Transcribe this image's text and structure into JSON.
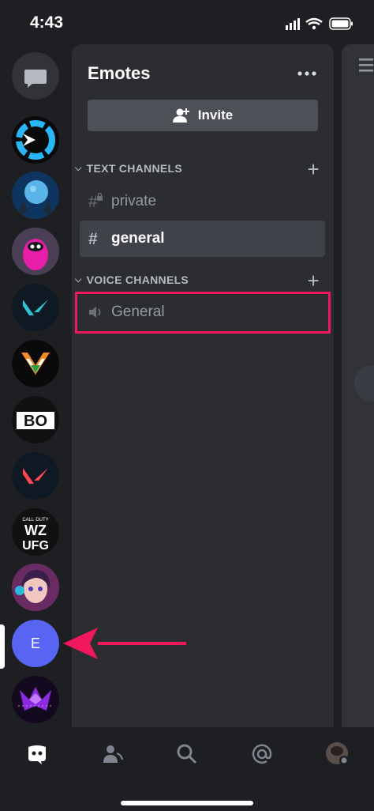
{
  "status_bar": {
    "time": "4:43"
  },
  "servers": [
    {
      "icon": "direct-messages-icon"
    },
    {
      "icon": "server-arrow-logo"
    },
    {
      "icon": "server-moon-logo"
    },
    {
      "icon": "server-fall-guys-logo"
    },
    {
      "icon": "server-valorant-teal-logo"
    },
    {
      "icon": "server-v-india-logo"
    },
    {
      "icon": "server-bo-logo"
    },
    {
      "icon": "server-valorant-red-logo"
    },
    {
      "icon": "server-wz-ufg-logo",
      "text_lines": [
        "CALL·DUTY",
        "WZ",
        "UFG"
      ]
    },
    {
      "icon": "server-anime-avatar"
    },
    {
      "icon": "server-emotes",
      "letter": "E",
      "selected": true
    },
    {
      "icon": "server-purple-logo"
    }
  ],
  "panel": {
    "server_name": "Emotes",
    "invite_label": "Invite",
    "categories": [
      {
        "name": "TEXT CHANNELS",
        "channels": [
          {
            "name": "private",
            "type": "text-locked",
            "selected": false
          },
          {
            "name": "general",
            "type": "text",
            "selected": true
          }
        ]
      },
      {
        "name": "VOICE CHANNELS",
        "channels": [
          {
            "name": "General",
            "type": "voice",
            "highlighted": true
          }
        ]
      }
    ]
  },
  "bottom_nav": [
    "discord-home-icon",
    "friends-icon",
    "search-icon",
    "mentions-icon",
    "profile-avatar"
  ],
  "colors": {
    "background": "#1e1f22",
    "panel": "#2b2d31",
    "selected_channel": "#404249",
    "highlight": "#f2185e",
    "emotes_server": "#5865f2"
  }
}
